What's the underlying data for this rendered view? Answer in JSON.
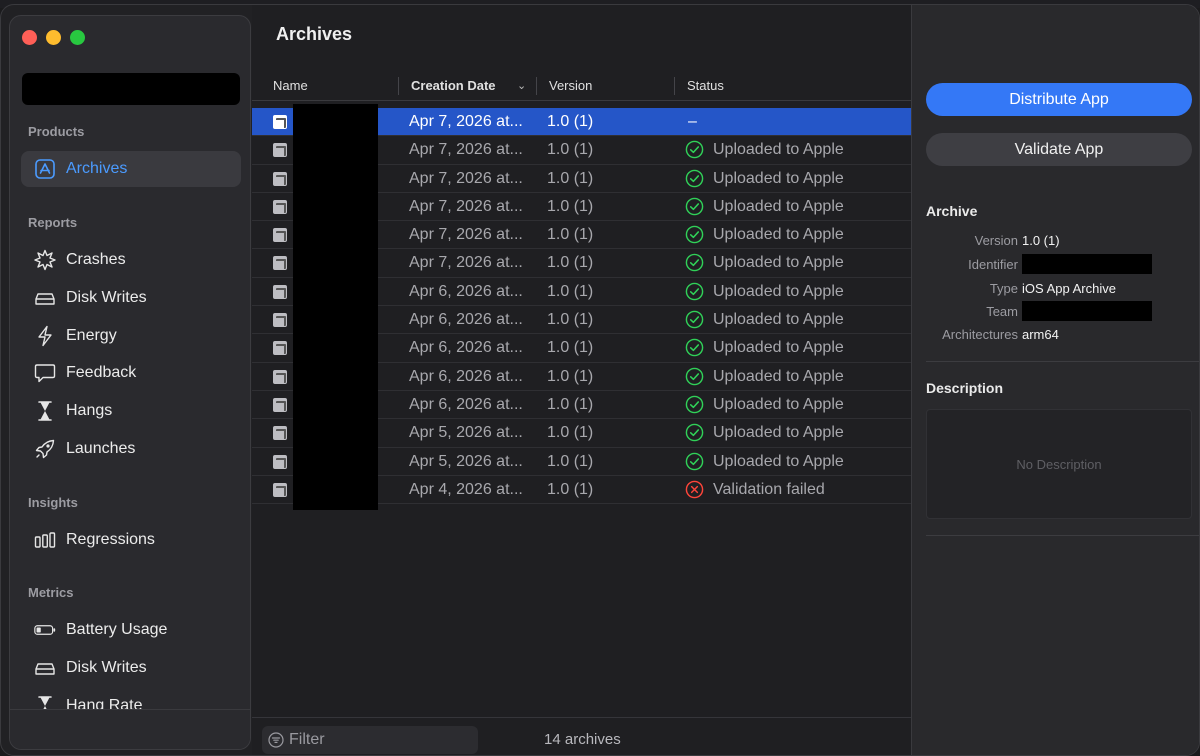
{
  "sidebar": {
    "products_title": "Products",
    "archives_label": "Archives",
    "reports_title": "Reports",
    "reports": [
      {
        "label": "Crashes",
        "icon": "burst-icon"
      },
      {
        "label": "Disk Writes",
        "icon": "disk-icon"
      },
      {
        "label": "Energy",
        "icon": "bolt-icon"
      },
      {
        "label": "Feedback",
        "icon": "speech-bubble-icon"
      },
      {
        "label": "Hangs",
        "icon": "hourglass-icon"
      },
      {
        "label": "Launches",
        "icon": "rocket-icon"
      }
    ],
    "insights_title": "Insights",
    "regressions_label": "Regressions",
    "metrics_title": "Metrics",
    "metrics": [
      {
        "label": "Battery Usage",
        "icon": "battery-icon"
      },
      {
        "label": "Disk Writes",
        "icon": "disk-icon"
      },
      {
        "label": "Hang Rate",
        "icon": "hourglass-icon"
      }
    ]
  },
  "main": {
    "title": "Archives",
    "columns": {
      "name": "Name",
      "creation_date": "Creation Date",
      "version": "Version",
      "status": "Status"
    },
    "rows": [
      {
        "date": "Apr 7, 2026 at...",
        "version": "1.0 (1)",
        "status": "–",
        "state": "none",
        "selected": true
      },
      {
        "date": "Apr 7, 2026 at...",
        "version": "1.0 (1)",
        "status": "Uploaded to Apple",
        "state": "ok"
      },
      {
        "date": "Apr 7, 2026 at...",
        "version": "1.0 (1)",
        "status": "Uploaded to Apple",
        "state": "ok"
      },
      {
        "date": "Apr 7, 2026 at...",
        "version": "1.0 (1)",
        "status": "Uploaded to Apple",
        "state": "ok"
      },
      {
        "date": "Apr 7, 2026 at...",
        "version": "1.0 (1)",
        "status": "Uploaded to Apple",
        "state": "ok"
      },
      {
        "date": "Apr 7, 2026 at...",
        "version": "1.0 (1)",
        "status": "Uploaded to Apple",
        "state": "ok"
      },
      {
        "date": "Apr 6, 2026 at...",
        "version": "1.0 (1)",
        "status": "Uploaded to Apple",
        "state": "ok"
      },
      {
        "date": "Apr 6, 2026 at...",
        "version": "1.0 (1)",
        "status": "Uploaded to Apple",
        "state": "ok"
      },
      {
        "date": "Apr 6, 2026 at...",
        "version": "1.0 (1)",
        "status": "Uploaded to Apple",
        "state": "ok"
      },
      {
        "date": "Apr 6, 2026 at...",
        "version": "1.0 (1)",
        "status": "Uploaded to Apple",
        "state": "ok"
      },
      {
        "date": "Apr 6, 2026 at...",
        "version": "1.0 (1)",
        "status": "Uploaded to Apple",
        "state": "ok"
      },
      {
        "date": "Apr 5, 2026 at...",
        "version": "1.0 (1)",
        "status": "Uploaded to Apple",
        "state": "ok"
      },
      {
        "date": "Apr 5, 2026 at...",
        "version": "1.0 (1)",
        "status": "Uploaded to Apple",
        "state": "ok"
      },
      {
        "date": "Apr 4, 2026 at...",
        "version": "1.0 (1)",
        "status": "Validation failed",
        "state": "fail"
      }
    ],
    "filter_placeholder": "Filter",
    "count": "14 archives"
  },
  "inspector": {
    "distribute_label": "Distribute App",
    "validate_label": "Validate App",
    "archive_title": "Archive",
    "version_key": "Version",
    "version_value": "1.0 (1)",
    "identifier_key": "Identifier",
    "type_key": "Type",
    "type_value": "iOS App Archive",
    "team_key": "Team",
    "architectures_key": "Architectures",
    "architectures_value": "arm64",
    "description_title": "Description",
    "description_placeholder": "No Description"
  },
  "colors": {
    "accent": "#3478f6",
    "selection": "#2556c8",
    "status_ok": "#30d158",
    "status_fail": "#ff453a"
  }
}
